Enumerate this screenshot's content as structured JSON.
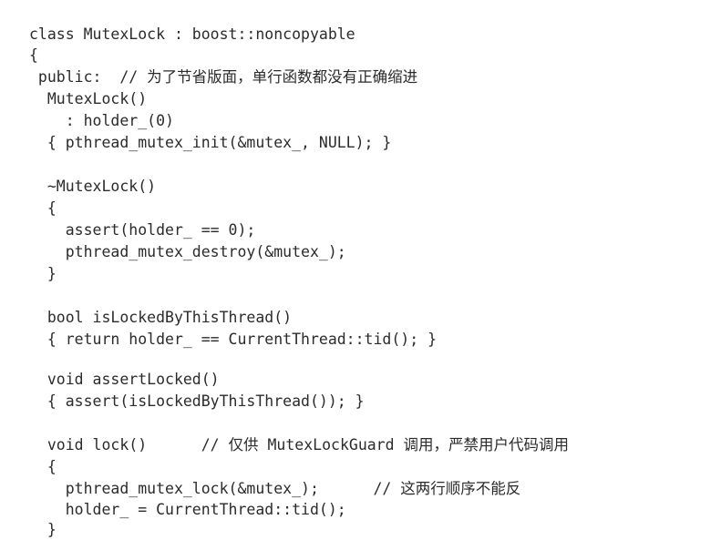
{
  "code": {
    "lines": [
      "class MutexLock : boost::noncopyable",
      "{",
      " public:  // 为了节省版面，单行函数都没有正确缩进",
      "  MutexLock()",
      "    : holder_(0)",
      "  { pthread_mutex_init(&mutex_, NULL); }",
      "",
      "  ~MutexLock()",
      "  {",
      "    assert(holder_ == 0);",
      "    pthread_mutex_destroy(&mutex_);",
      "  }",
      "",
      "  bool isLockedByThisThread()",
      "  { return holder_ == CurrentThread::tid(); }",
      "",
      "  void assertLocked()",
      "  { assert(isLockedByThisThread()); }",
      "",
      "  void lock()      // 仅供 MutexLockGuard 调用，严禁用户代码调用",
      "  {",
      "    pthread_mutex_lock(&mutex_);      // 这两行顺序不能反",
      "    holder_ = CurrentThread::tid();",
      "  }"
    ]
  }
}
